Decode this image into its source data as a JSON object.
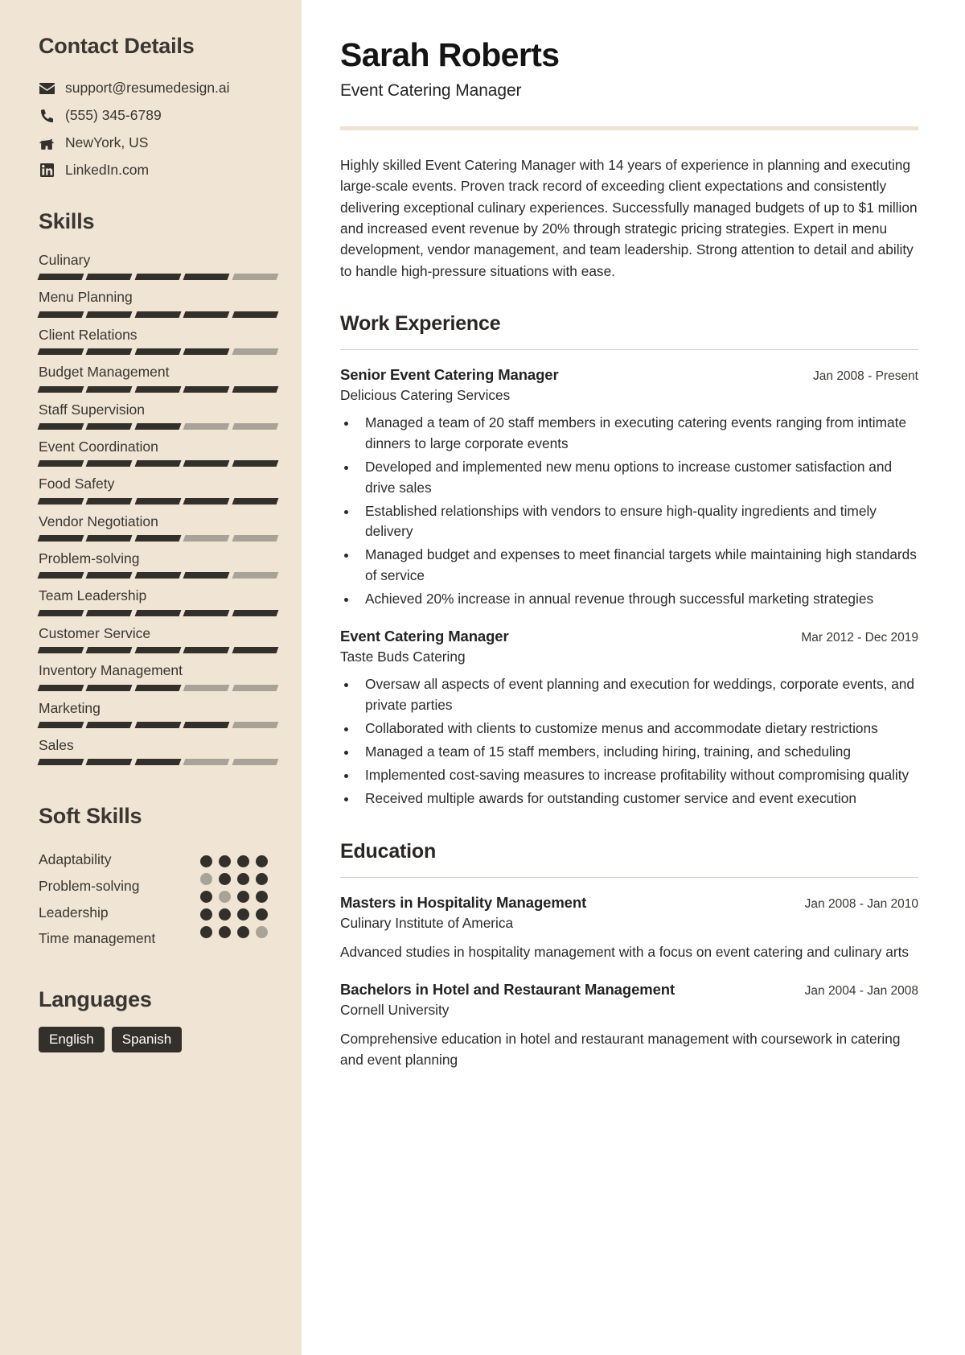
{
  "sidebar": {
    "contact_heading": "Contact Details",
    "contact": [
      {
        "icon": "envelope-icon",
        "value": "support@resumedesign.ai"
      },
      {
        "icon": "phone-icon",
        "value": "(555) 345-6789"
      },
      {
        "icon": "home-icon",
        "value": "NewYork, US"
      },
      {
        "icon": "linkedin-icon",
        "value": "LinkedIn.com"
      }
    ],
    "skills_heading": "Skills",
    "skills_max": 5,
    "skills": [
      {
        "name": "Culinary",
        "level": 4
      },
      {
        "name": "Menu Planning",
        "level": 5
      },
      {
        "name": "Client Relations",
        "level": 4
      },
      {
        "name": "Budget Management",
        "level": 5
      },
      {
        "name": "Staff Supervision",
        "level": 3
      },
      {
        "name": "Event Coordination",
        "level": 5
      },
      {
        "name": "Food Safety",
        "level": 5
      },
      {
        "name": "Vendor Negotiation",
        "level": 3
      },
      {
        "name": "Problem-solving",
        "level": 4
      },
      {
        "name": "Team Leadership",
        "level": 5
      },
      {
        "name": "Customer Service",
        "level": 5
      },
      {
        "name": "Inventory Management",
        "level": 3
      },
      {
        "name": "Marketing",
        "level": 4
      },
      {
        "name": "Sales",
        "level": 3
      }
    ],
    "soft_skills_heading": "Soft Skills",
    "soft_skills_max": 5,
    "soft_skills": [
      {
        "name": "Adaptability",
        "level": 4
      },
      {
        "name": "Problem-solving",
        "level": 4
      },
      {
        "name": "Leadership",
        "level": 5
      },
      {
        "name": "Time management",
        "level": 4
      }
    ],
    "languages_heading": "Languages",
    "languages": [
      "English",
      "Spanish"
    ]
  },
  "main": {
    "name": "Sarah Roberts",
    "role": "Event Catering Manager",
    "summary": "Highly skilled Event Catering Manager with 14 years of experience in planning and executing large-scale events. Proven track record of exceeding client expectations and consistently delivering exceptional culinary experiences. Successfully managed budgets of up to $1 million and increased event revenue by 20% through strategic pricing strategies. Expert in menu development, vendor management, and team leadership. Strong attention to detail and ability to handle high-pressure situations with ease.",
    "work_heading": "Work Experience",
    "work": [
      {
        "title": "Senior Event Catering Manager",
        "date": "Jan 2008 - Present",
        "company": "Delicious Catering Services",
        "bullets": [
          "Managed a team of 20 staff members in executing catering events ranging from intimate dinners to large corporate events",
          "Developed and implemented new menu options to increase customer satisfaction and drive sales",
          "Established relationships with vendors to ensure high-quality ingredients and timely delivery",
          "Managed budget and expenses to meet financial targets while maintaining high standards of service",
          "Achieved 20% increase in annual revenue through successful marketing strategies"
        ]
      },
      {
        "title": "Event Catering Manager",
        "date": "Mar 2012 - Dec 2019",
        "company": "Taste Buds Catering",
        "bullets": [
          "Oversaw all aspects of event planning and execution for weddings, corporate events, and private parties",
          "Collaborated with clients to customize menus and accommodate dietary restrictions",
          "Managed a team of 15 staff members, including hiring, training, and scheduling",
          "Implemented cost-saving measures to increase profitability without compromising quality",
          "Received multiple awards for outstanding customer service and event execution"
        ]
      }
    ],
    "education_heading": "Education",
    "education": [
      {
        "title": "Masters in Hospitality Management",
        "date": "Jan 2008 - Jan 2010",
        "school": "Culinary Institute of America",
        "description": "Advanced studies in hospitality management with a focus on event catering and culinary arts"
      },
      {
        "title": "Bachelors in Hotel and Restaurant Management",
        "date": "Jan 2004 - Jan 2008",
        "school": "Cornell University",
        "description": "Comprehensive education in hotel and restaurant management with coursework in catering and event planning"
      }
    ]
  },
  "colors": {
    "sidebar_bg": "#F0E4D5",
    "ink": "#332F2B",
    "muted_bar": "#A9A299",
    "accent_rule": "#EDE2D4"
  }
}
